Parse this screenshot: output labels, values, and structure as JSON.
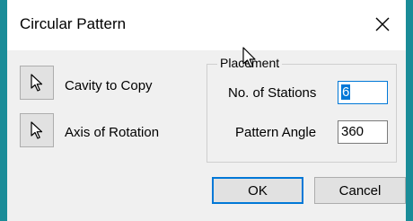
{
  "dialog": {
    "title": "Circular Pattern",
    "close_icon": "close-icon"
  },
  "selection": {
    "cavity_label": "Cavity to Copy",
    "axis_label": "Axis of Rotation",
    "pick_icon": "arrow-pointer-icon"
  },
  "placement": {
    "group_title": "Placement",
    "stations_label": "No. of Stations",
    "stations_value": "6",
    "angle_label": "Pattern Angle",
    "angle_value": "360"
  },
  "buttons": {
    "ok_label": "OK",
    "cancel_label": "Cancel"
  }
}
